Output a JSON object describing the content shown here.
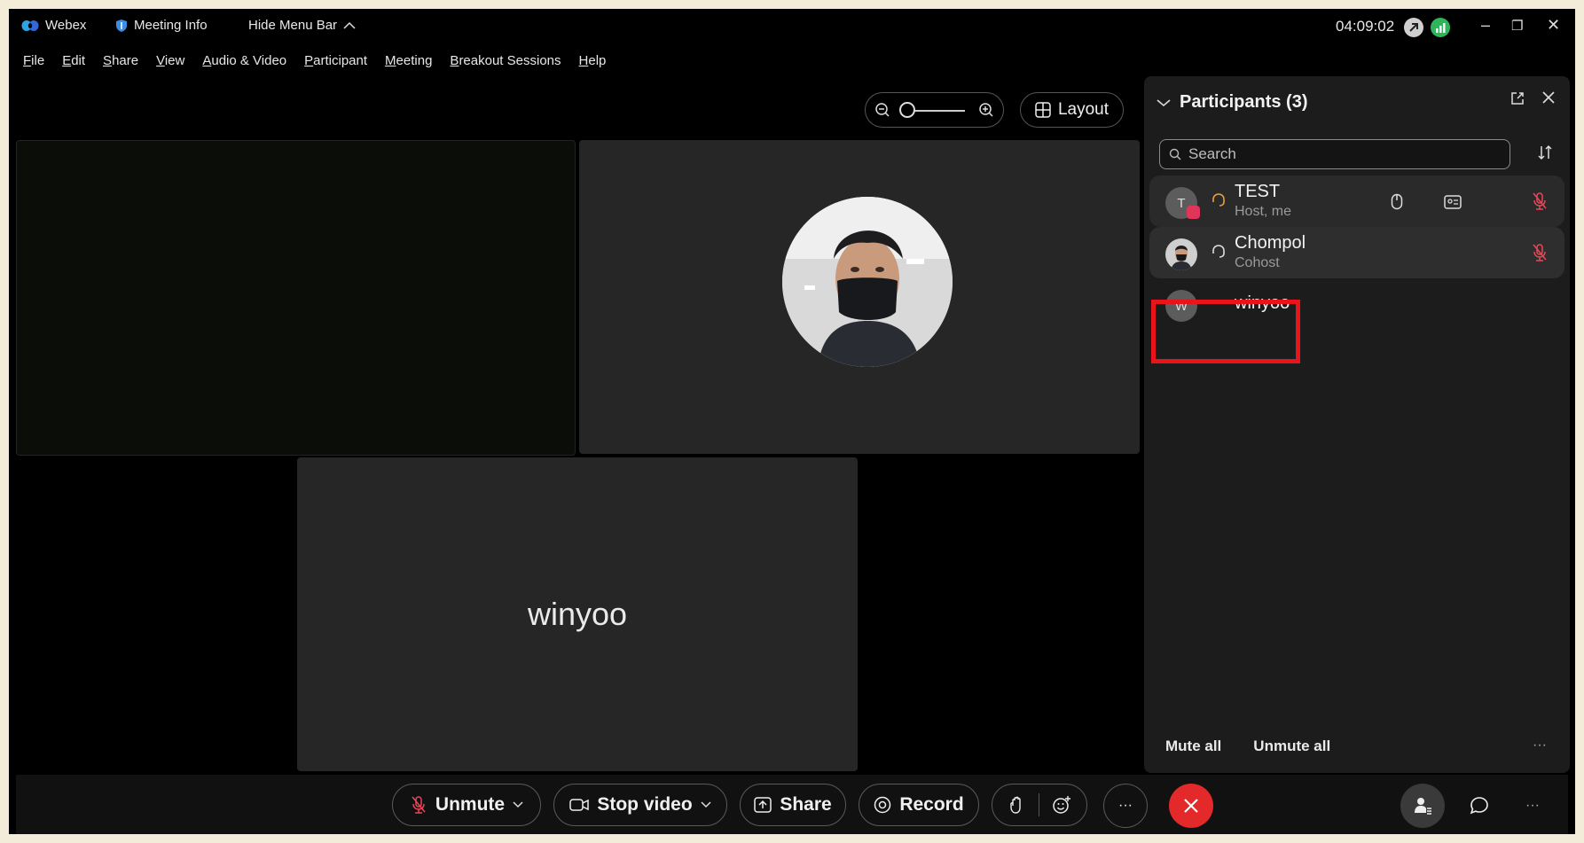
{
  "titlebar": {
    "app_name": "Webex",
    "meeting_info": "Meeting Info",
    "hide_menu_bar": "Hide Menu Bar",
    "clock": "04:09:02"
  },
  "menu": [
    {
      "u": "F",
      "rest": "ile"
    },
    {
      "u": "E",
      "rest": "dit"
    },
    {
      "u": "S",
      "rest": "hare"
    },
    {
      "u": "V",
      "rest": "iew"
    },
    {
      "u": "A",
      "rest": "udio & Video"
    },
    {
      "u": "P",
      "rest": "articipant"
    },
    {
      "u": "M",
      "rest": "eeting"
    },
    {
      "u": "B",
      "rest": "reakout Sessions"
    },
    {
      "u": "H",
      "rest": "elp"
    }
  ],
  "layout_label": "Layout",
  "tiles": {
    "tile3_name": "winyoo"
  },
  "participants": {
    "header": "Participants (3)",
    "search_placeholder": "Search",
    "rows": [
      {
        "initial": "T",
        "name": "TEST",
        "role": "Host, me"
      },
      {
        "initial": "",
        "name": "Chompol",
        "role": "Cohost"
      },
      {
        "initial": "W",
        "name": "winyoo",
        "role": ""
      }
    ],
    "mute_all": "Mute all",
    "unmute_all": "Unmute all",
    "more": "···"
  },
  "toolbar": {
    "unmute": "Unmute",
    "stop_video": "Stop video",
    "share": "Share",
    "record": "Record",
    "more": "···"
  },
  "colors": {
    "end_call": "#e32929",
    "highlight": "#e8141a",
    "accent_webex": "#3a8ee6"
  }
}
